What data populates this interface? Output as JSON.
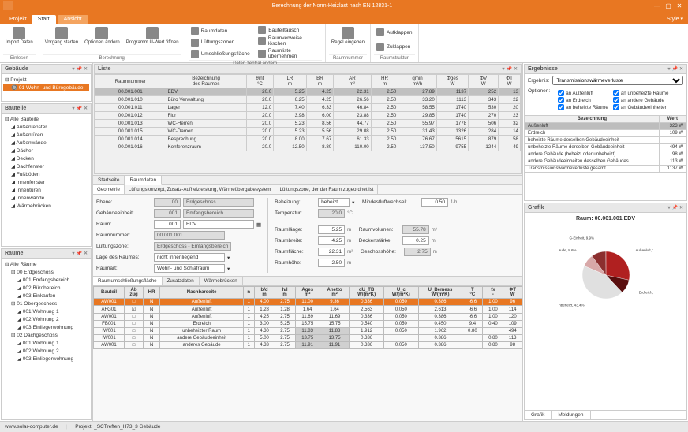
{
  "window": {
    "title": "Berechnung der Norm-Heizlast nach EN 12831-1"
  },
  "tabs": {
    "file": "Projekt",
    "start": "Start",
    "view": "Ansicht",
    "style": "Style ▾"
  },
  "ribbon": {
    "g1": {
      "lbl": "Einlesen",
      "b1": "Import\nDaten"
    },
    "g2": {
      "lbl": "Berechnung",
      "b1": "Vorgang\nstarten",
      "b2": "Optionen\nändern",
      "b3": "Programm\nU-Wert öffnen"
    },
    "g3": {
      "lbl": "Daten zentral ändern",
      "i1": "Raumdaten",
      "i2": "Lüftungszonen",
      "i3": "Umschließungsfläche",
      "i4": "Bauteiltausch",
      "i5": "Raumverweise löschen",
      "i6": "Raumliste übernehmen"
    },
    "g4": {
      "lbl": "Raumnummer",
      "b1": "Regel\neingeben"
    },
    "g5": {
      "lbl": "Raumstruktur",
      "i1": "Aufklappen",
      "i2": "Zuklappen"
    }
  },
  "panels": {
    "gebaeude": "Gebäude",
    "bauteile": "Bauteile",
    "raeume": "Räume",
    "liste": "Liste",
    "ergebnisse": "Ergebnisse",
    "grafik": "Grafik"
  },
  "gebaeude_tree": {
    "root": "Projekt",
    "item1": "01 Wohn- und Bürogebäude"
  },
  "bauteile_tree": [
    "Alle Bauteile",
    "Außenfenster",
    "Außentüren",
    "Außenwände",
    "Dächer",
    "Decken",
    "Dachfenster",
    "Fußböden",
    "Innenfenster",
    "Innentüren",
    "Innenwände",
    "Wärmebrücken"
  ],
  "raeume_tree": {
    "root": "Alle Räume",
    "groups": [
      {
        "lbl": "00 Erdgeschoss",
        "items": [
          "001 Emfangsbereich",
          "002 Bürobereich",
          "003 Einkaufen"
        ]
      },
      {
        "lbl": "01 Obergeschoss",
        "items": [
          "001 Wohnung 1",
          "002 Wohnung 2",
          "003 Einliegerwohnung"
        ]
      },
      {
        "lbl": "02 Dachgeschoss",
        "items": [
          "001 Wohnung 1",
          "002 Wohnung 2",
          "003 Einliegerwohnung"
        ]
      }
    ]
  },
  "liste": {
    "headers": [
      "Raumnummer",
      "Bezeichnung\ndes Raumes",
      "θint\n°C",
      "LR\nm",
      "BR\nm",
      "AR\nm²",
      "HR\nm",
      "qmin\nm³/h",
      "Φges\nW",
      "ΦV\nW",
      "ΦT\nW"
    ],
    "rows": [
      [
        "00.001.001",
        "EDV",
        "20.0",
        "5.25",
        "4.25",
        "22.31",
        "2.50",
        "27.89",
        "1137",
        "252",
        "13"
      ],
      [
        "00.001.010",
        "Büro Verwaltung",
        "20.0",
        "6.25",
        "4.25",
        "26.56",
        "2.50",
        "33.20",
        "1113",
        "343",
        "22"
      ],
      [
        "00.001.011",
        "Lager",
        "12.0",
        "7.40",
        "6.33",
        "46.84",
        "2.50",
        "58.55",
        "1740",
        "530",
        "20"
      ],
      [
        "00.001.012",
        "Flur",
        "20.0",
        "3.98",
        "6.00",
        "23.88",
        "2.50",
        "29.85",
        "1740",
        "270",
        "23"
      ],
      [
        "00.001.013",
        "WC-Herren",
        "20.0",
        "5.23",
        "8.56",
        "44.77",
        "2.50",
        "55.97",
        "1778",
        "506",
        "32"
      ],
      [
        "00.001.015",
        "WC-Damen",
        "20.0",
        "5.23",
        "5.56",
        "29.08",
        "2.50",
        "31.43",
        "1326",
        "284",
        "14"
      ],
      [
        "00.001.014",
        "Besprechung",
        "20.0",
        "8.00",
        "7.67",
        "61.33",
        "2.50",
        "76.67",
        "5615",
        "879",
        "58"
      ],
      [
        "00.001.016",
        "Konferenzraum",
        "20.0",
        "12.50",
        "8.80",
        "110.00",
        "2.50",
        "137.50",
        "9755",
        "1244",
        "49"
      ]
    ],
    "selected": 0
  },
  "detail": {
    "tabs": [
      "Startseite",
      "Raumdaten"
    ],
    "subtabs": [
      "Geometrie",
      "Lüftungskonzept, Zusatz-Aufheizleistung, Wärmeübergabesystem",
      "Lüftungszone, der der Raum zugeordnet ist"
    ],
    "form": {
      "ebene": {
        "lbl": "Ebene:",
        "c": "00",
        "n": "Erdgeschoss"
      },
      "geb": {
        "lbl": "Gebäudeeinheit:",
        "c": "001",
        "n": "Emfangsbereich"
      },
      "raum": {
        "lbl": "Raum:",
        "c": "001",
        "n": "EDV"
      },
      "raumnr": {
        "lbl": "Raumnummer:",
        "v": "00.001.001"
      },
      "zone": {
        "lbl": "Lüftungszone:",
        "v": "Erdgeschoss - Emfangsbereich"
      },
      "lage": {
        "lbl": "Lage des Raumes:",
        "v": "nicht innenliegend"
      },
      "art": {
        "lbl": "Raumart:",
        "v": "Wohn- und Schlafraum"
      },
      "beheizung": {
        "lbl": "Beheizung:",
        "v": "beheizt"
      },
      "temp": {
        "lbl": "Temperatur:",
        "v": "20.0",
        "u": "°C"
      },
      "mlw": {
        "lbl": "Mindestluftwechsel:",
        "v": "0.50",
        "u": "1/h"
      },
      "rl": {
        "lbl": "Raumlänge:",
        "v": "5.25",
        "u": "m"
      },
      "rb": {
        "lbl": "Raumbreite:",
        "v": "4.25",
        "u": "m"
      },
      "rf": {
        "lbl": "Raumfläche:",
        "v": "22.31",
        "u": "m²"
      },
      "rh": {
        "lbl": "Raumhöhe:",
        "v": "2.50",
        "u": "m"
      },
      "rv": {
        "lbl": "Raumvolumen:",
        "v": "55.78",
        "u": "m³"
      },
      "ds": {
        "lbl": "Deckenstärke:",
        "v": "0.25",
        "u": "m"
      },
      "gh": {
        "lbl": "Geschosshöhe:",
        "v": "2.75",
        "u": "m"
      }
    },
    "bauteil_tabs": [
      "Raumumschließungsfläche",
      "Zusatzdaten",
      "Wärmebrücken"
    ],
    "bauteil": {
      "headers": [
        "Bauteil",
        "Ab\nzug",
        "HR",
        "Nachbarseite",
        "n",
        "b/d\nm",
        "h/l\nm",
        "Ages\nm²",
        "Anetto\nm²",
        "dU_TB\nW/(m²K)",
        "U_c\nW/(m²K)",
        "U_Bemess\nW/(m²K)",
        "T\n°C",
        "fx\n-",
        "ΦT\nW"
      ],
      "rows": [
        [
          "AW001",
          "□",
          "N",
          "Außenluft",
          "1",
          "4.00",
          "2.75",
          "11.00",
          "9.36",
          "0.336",
          "0.050",
          "0.386",
          "-6.6",
          "1.00",
          "96"
        ],
        [
          "AFG01",
          "☑",
          "N",
          "Außenluft",
          "1",
          "1.28",
          "1.28",
          "1.64",
          "1.64",
          "2.563",
          "0.050",
          "2.613",
          "-6.6",
          "1.00",
          "114"
        ],
        [
          "AW001",
          "□",
          "N",
          "Außenluft",
          "1",
          "4.25",
          "2.75",
          "11.69",
          "11.69",
          "0.336",
          "0.050",
          "0.386",
          "-6.6",
          "1.00",
          "120"
        ],
        [
          "FB001",
          "□",
          "N",
          "Erdreich",
          "1",
          "3.00",
          "5.25",
          "15.75",
          "15.75",
          "0.540",
          "0.050",
          "0.450",
          "9.4",
          "0.40",
          "109"
        ],
        [
          "IW001",
          "□",
          "N",
          "unbeheizter Raum",
          "1",
          "4.30",
          "2.75",
          "11.83",
          "11.83",
          "1.912",
          "0.050",
          "1.962",
          "0.80",
          "",
          "494"
        ],
        [
          "IW001",
          "□",
          "N",
          "andere Gebäudeeinheit",
          "1",
          "5.00",
          "2.75",
          "13.75",
          "13.75",
          "0.336",
          "",
          "0.386",
          "",
          "0.80",
          "113"
        ],
        [
          "AW001",
          "□",
          "N",
          "anderes Gebäude",
          "1",
          "4.33",
          "2.75",
          "11.91",
          "11.91",
          "0.336",
          "0.050",
          "0.386",
          "",
          "0.80",
          "98"
        ]
      ],
      "selected": 0
    }
  },
  "ergebnisse": {
    "lbl_ergebnis": "Ergebnis:",
    "sel": "Transmissionswärmeverluste",
    "lbl_opt": "Optionen:",
    "checks": {
      "c1": "an Außenluft",
      "c2": "an Erdreich",
      "c3": "an beheizte Räume",
      "c4": "an unbeheizte Räume",
      "c5": "an andere Gebäude",
      "c6": "an Gebäudeeinheiten"
    },
    "headers": [
      "Bezeichnung",
      "Wert"
    ],
    "rows": [
      [
        "Außenluft",
        "323 W"
      ],
      [
        "Erdreich",
        "109 W"
      ],
      [
        "beheizte Räume derselben Gebäudeeinheit",
        ""
      ],
      [
        "unbeheizte Räume derselben Gebäudeeinheit",
        "494 W"
      ],
      [
        "andere Gebäude (beheizt oder unbeheizt)",
        "98 W"
      ],
      [
        "andere Gebäudeeinheiten desselben Gebäudes",
        "113 W"
      ],
      [
        "Transmissionswärmeverluste gesamt",
        "1137 W"
      ]
    ],
    "selected": 0
  },
  "grafik": {
    "title": "Raum: 00.001.001 EDV",
    "tabs": [
      "Grafik",
      "Meldungen"
    ]
  },
  "chart_data": {
    "type": "pie",
    "title": "Raum: 00.001.001 EDV",
    "series": [
      {
        "name": "Außenluft",
        "value": 28.4,
        "color": "#b02020"
      },
      {
        "name": "Erdreich",
        "value": 9.6,
        "color": "#5a0e0e"
      },
      {
        "name": "unbeheizt",
        "value": 43.4,
        "color": "#e0e0e0"
      },
      {
        "name": "Gebäude",
        "value": 8.6,
        "color": "#d8a8a8"
      },
      {
        "name": "G-Einheit",
        "value": 9.9,
        "color": "#8c2f2f"
      }
    ]
  },
  "status": {
    "url": "www.solar-computer.de",
    "proj": "Projekt: _SCTreffen_H73_3 Gebäude"
  }
}
